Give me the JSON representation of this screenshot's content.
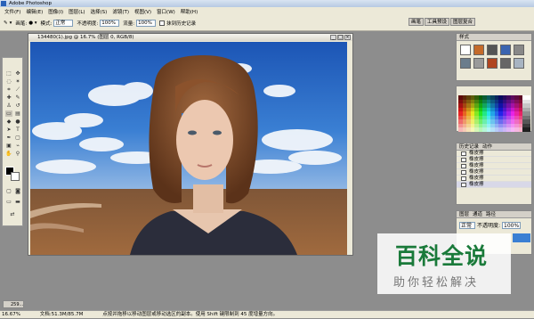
{
  "window": {
    "title": "Adobe Photoshop"
  },
  "menu": [
    "文件(F)",
    "编辑(E)",
    "图像(I)",
    "图层(L)",
    "选择(S)",
    "滤镜(T)",
    "视图(V)",
    "窗口(W)",
    "帮助(H)"
  ],
  "options": {
    "brush_label": "画笔:",
    "mode_label": "模式:",
    "mode_value": "正常",
    "opacity_label": "不透明度:",
    "opacity_value": "100%",
    "flow_label": "流量:",
    "flow_value": "100%",
    "history_check_label": "抹到历史记录",
    "tabs": [
      "画笔",
      "工具预设",
      "图层复合"
    ]
  },
  "document": {
    "title": "134480(1).jpg @ 16.7% (图层 0, RGB/8)",
    "zoom": "16.67%",
    "doc_size": "文档:51.3M/85.7M"
  },
  "panels": {
    "styles_tab": "样式",
    "history_tabs": [
      "历史记录",
      "动作"
    ],
    "history_items": [
      "橡皮擦",
      "橡皮擦",
      "橡皮擦",
      "橡皮擦",
      "橡皮擦",
      "橡皮擦"
    ],
    "layers_tabs": [
      "图层",
      "通道",
      "路径"
    ],
    "layers_mode": "正常",
    "layers_opacity_label": "不透明度:",
    "layers_opacity_value": "100%"
  },
  "statusbar": {
    "zoom": "16.67%",
    "doc": "文档:51.3M/85.7M",
    "hint": "点按并拖移以移动图层或移动选区的副本。使用 Shift 键限制到 45 度增量方向。"
  },
  "taskbar": {
    "min_label": "259..."
  },
  "watermark": {
    "title": "百科全说",
    "subtitle": "助你轻松解决"
  },
  "colors": {
    "sky": "#2f6fc9",
    "field": "#8a5a35",
    "hair": "#7a4526",
    "watermark_green": "#1a7a3a"
  }
}
